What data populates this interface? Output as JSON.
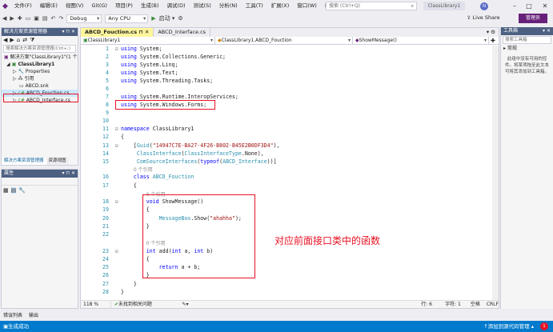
{
  "menu": [
    "文件(F)",
    "编辑(E)",
    "视图(V)",
    "Git(G)",
    "项目(P)",
    "生成(B)",
    "调试(D)",
    "测试(S)",
    "分析(N)",
    "工具(T)",
    "扩展(X)",
    "窗口(W)",
    "帮助(H)"
  ],
  "search_placeholder": "搜索 (Ctrl+Q)",
  "solution_badge": "ClassLibrary1",
  "avatar_initial": "N",
  "toolbar": {
    "config": "Debug",
    "platform": "Any CPU",
    "start_label": "启动 ▾",
    "live_share": "Live Share",
    "admin": "管理员"
  },
  "explorer": {
    "title": "解决方案资源管理器",
    "search_placeholder": "搜索解决方案资源管理器(Ctrl+;)",
    "solution": "解决方案\"ClassLibrary1\"(1 个",
    "project": "ClassLibrary1",
    "items": [
      "Properties",
      "引用",
      "ABCD.snk",
      "ABCD_Fouction.cs",
      "ABCD_Interface.cs"
    ],
    "tab_explorer": "解决方案资源管理器",
    "tab_view": "资源视图"
  },
  "properties": {
    "title": "属性"
  },
  "editor": {
    "tabs": [
      "ABCD_Fouction.cs",
      "ABCD_Interface.cs"
    ],
    "nav": [
      "ClassLibrary1",
      "ClassLibrary1.ABCD_Fouction",
      "ShowMessage()"
    ],
    "zoom": "118 %",
    "no_issues": "未找到相关问题",
    "line": "行: 6",
    "col": "字符: 1",
    "spaces": "空格",
    "eol": "CRLF"
  },
  "annotation": "对应前面接口类中的函数",
  "toolbox": {
    "title": "工具箱",
    "search": "搜索工具箱",
    "group": "▸ 常规",
    "empty_msg": "此组中没有可用的控件。将某项拖至此文本可将其添加到工具箱。"
  },
  "bottom_tabs": [
    "错误列表",
    "输出"
  ],
  "status": {
    "message": "生成成功",
    "source_control": "添加到源代码管理 ▴",
    "notif": "1"
  },
  "refs0": "0 个引用"
}
